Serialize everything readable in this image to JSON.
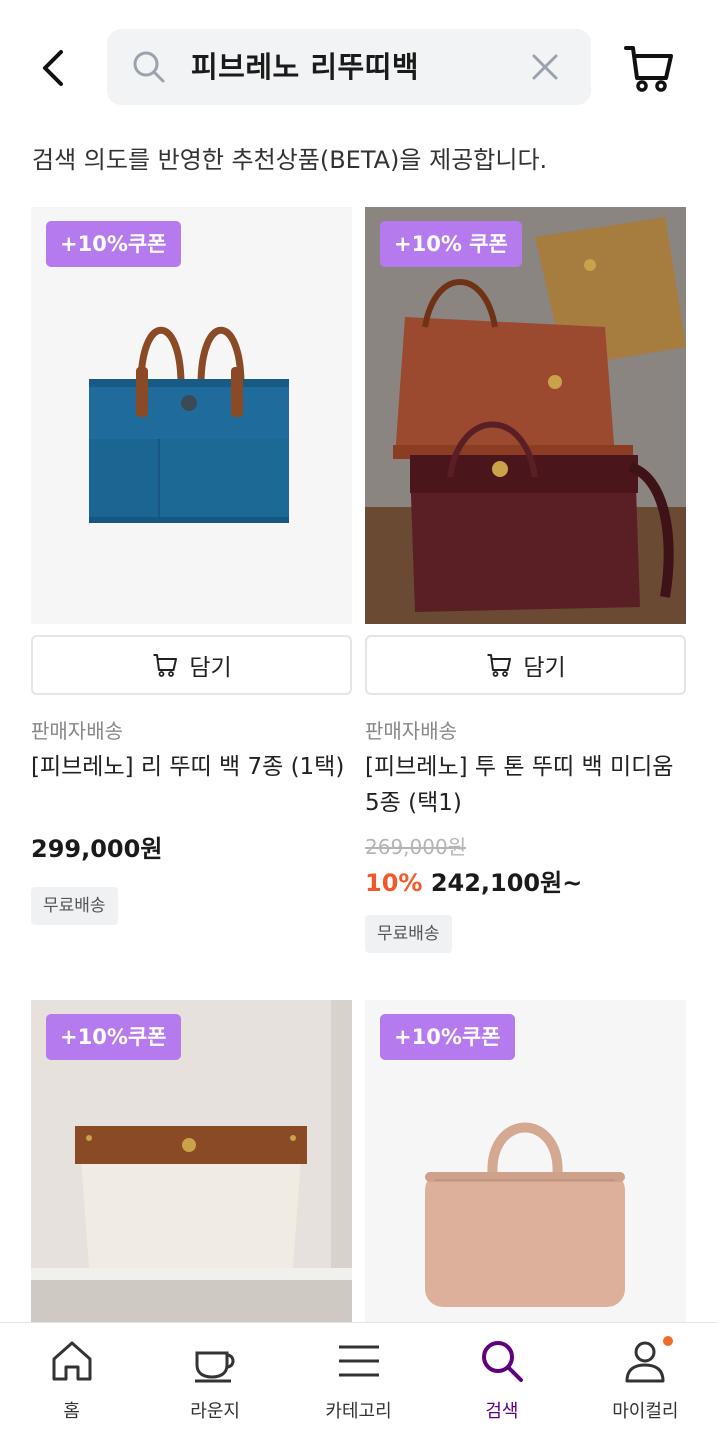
{
  "header": {
    "search_query": "피브레노 리뚜띠백"
  },
  "notice": "검색 의도를 반영한 추천상품(BETA)을 제공합니다.",
  "products": [
    {
      "coupon": "+10%쿠폰",
      "cart_label": "담기",
      "seller": "판매자배송",
      "title": "[피브레노] 리 뚜띠 백 7종 (1택)",
      "price": "299,000원",
      "badge": "무료배송"
    },
    {
      "coupon": "+10% 쿠폰",
      "cart_label": "담기",
      "seller": "판매자배송",
      "title": "[피브레노] 투 톤 뚜띠 백 미디움 5종 (택1)",
      "original_price": "269,000원",
      "discount": "10%",
      "price": "242,100원~",
      "badge": "무료배송"
    },
    {
      "coupon": "+10%쿠폰"
    },
    {
      "coupon": "+10%쿠폰"
    }
  ],
  "bottom_nav": [
    {
      "label": "홈",
      "icon": "home-icon"
    },
    {
      "label": "라운지",
      "icon": "coffee-cup-icon"
    },
    {
      "label": "카테고리",
      "icon": "menu-icon"
    },
    {
      "label": "검색",
      "icon": "search-icon",
      "active": true
    },
    {
      "label": "마이컬리",
      "icon": "user-icon"
    }
  ],
  "colors": {
    "accent": "#5f0080",
    "coupon_bg": "#b57aed",
    "discount": "#f05a28"
  }
}
